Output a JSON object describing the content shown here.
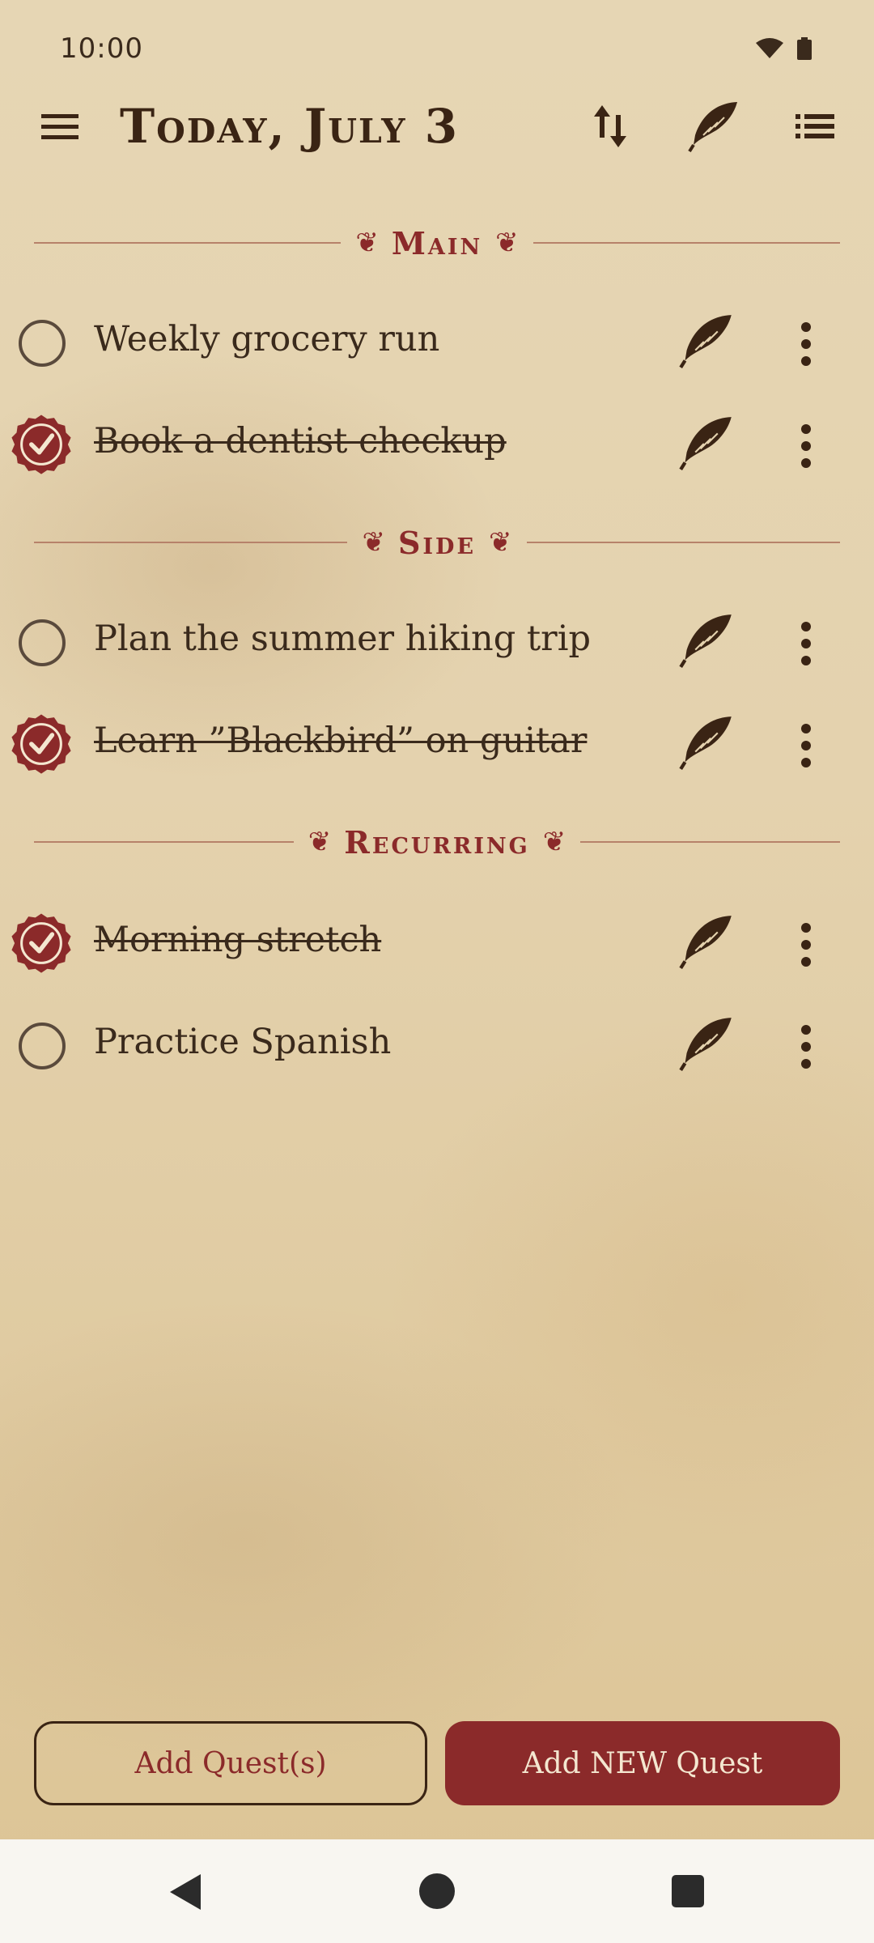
{
  "status": {
    "time": "10:00"
  },
  "header": {
    "title": "Today, July 3"
  },
  "sections": [
    {
      "label": "Main",
      "tasks": [
        {
          "text": "Weekly grocery run",
          "done": false
        },
        {
          "text": "Book a dentist checkup",
          "done": true
        }
      ]
    },
    {
      "label": "Side",
      "tasks": [
        {
          "text": "Plan the summer hiking trip",
          "done": false
        },
        {
          "text": "Learn ”Blackbird” on guitar",
          "done": true
        }
      ]
    },
    {
      "label": "Recurring",
      "tasks": [
        {
          "text": "Morning stretch",
          "done": true
        },
        {
          "text": "Practice Spanish",
          "done": false
        }
      ]
    }
  ],
  "buttons": {
    "add_quests": "Add Quest(s)",
    "add_new": "Add NEW Quest"
  },
  "colors": {
    "accent": "#8b2a2a",
    "ink": "#3a2a1c",
    "parchment": "#e4d2ae"
  },
  "icons": {
    "menu": "menu-icon",
    "sort": "sort-icon",
    "quill": "quill-icon",
    "list": "list-icon",
    "more": "more-vert-icon"
  }
}
